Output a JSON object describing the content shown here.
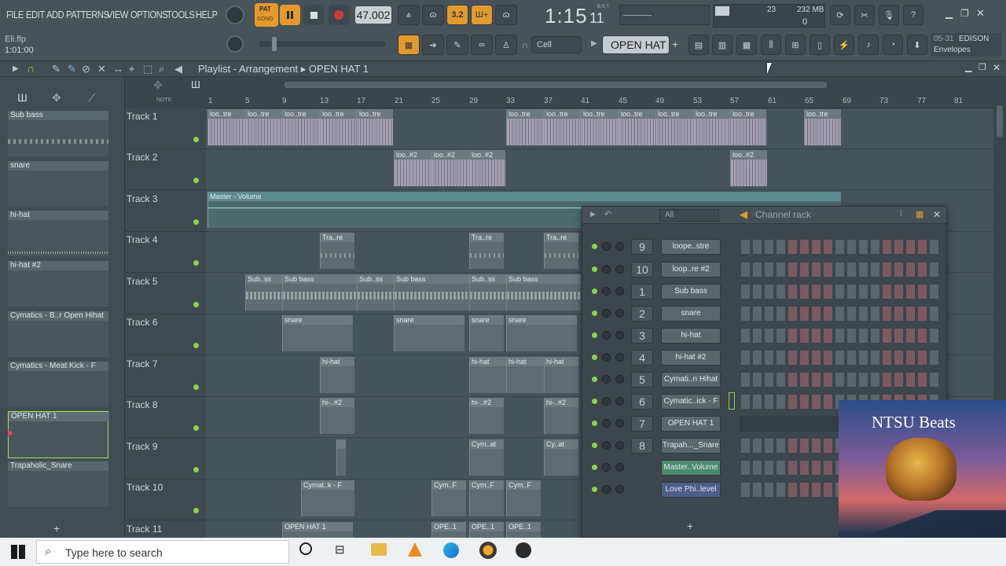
{
  "menu": {
    "items": [
      "FILE",
      "EDIT",
      "ADD",
      "PATTERNS",
      "VIEW",
      "OPTIONS",
      "TOOLS",
      "HELP"
    ]
  },
  "transport": {
    "pat_label": "PAT",
    "song_label": "SONG",
    "tempo": "47.002",
    "time": "1:15",
    "time_sub": "11",
    "time_sup": "B:S:T"
  },
  "monitor": {
    "cpu": "23",
    "ram": "232 MB",
    "voices": "0"
  },
  "project": {
    "file": "Eli.flp",
    "time": "1:01:00"
  },
  "snap": {
    "value": "Cell"
  },
  "pattern_selector": {
    "value": "OPEN HAT 1"
  },
  "hint": {
    "date": "05-31",
    "plugin": "EDISON",
    "sub": "Envelopes"
  },
  "playlist": {
    "title": "Playlist - Arrangement",
    "pattern": "OPEN HAT 1"
  },
  "ruler": {
    "marks": [
      "1",
      "5",
      "9",
      "13",
      "17",
      "21",
      "25",
      "29",
      "33",
      "37",
      "41",
      "45",
      "49",
      "53",
      "57",
      "61",
      "65",
      "69",
      "73",
      "77",
      "81"
    ]
  },
  "patterns": [
    {
      "name": "Sub bass"
    },
    {
      "name": "snare"
    },
    {
      "name": "hi-hat"
    },
    {
      "name": "hi-hat #2"
    },
    {
      "name": "Cymatics - B..r Open Hihat"
    },
    {
      "name": "Cymatics - Meat Kick - F"
    },
    {
      "name": "OPEN HAT 1"
    },
    {
      "name": "Trapaholic_Snare"
    }
  ],
  "tracks": [
    "Track 1",
    "Track 2",
    "Track 3",
    "Track 4",
    "Track 5",
    "Track 6",
    "Track 7",
    "Track 8",
    "Track 9",
    "Track 10",
    "Track 11"
  ],
  "clips": {
    "t1": [
      "loo..tre",
      "loo..tre",
      "loo..tre",
      "loo..tre",
      "loo..tre",
      "loo..tre",
      "loo..tre",
      "loo..tre",
      "loo..tre",
      "loo..tre",
      "loo..tre",
      "loo..tre",
      "loo..tre"
    ],
    "t2": [
      "loo..#2",
      "loo..#2",
      "loo..#2",
      "loo..#2"
    ],
    "t3": "Master - Volume",
    "t4": [
      "Tra..re",
      "Tra..re",
      "Tra..re"
    ],
    "t5": [
      "Sub..ss",
      "Sub bass",
      "Sub..ss",
      "Sub bass",
      "Sub..ss",
      "Sub bass"
    ],
    "t6": [
      "snare",
      "snare",
      "snare",
      "snare"
    ],
    "t7": [
      "hi-hat",
      "hi-hat",
      "hi-hat",
      "hi-hat"
    ],
    "t8": [
      "hi-..#2",
      "hi-..#2",
      "hi-..#2"
    ],
    "t9": [
      "Cym..at",
      "Cy..at"
    ],
    "t10": [
      "Cymat..k - F",
      "Cym..F",
      "Cym..F",
      "Cym..F"
    ],
    "t11": [
      "OPEN HAT 1",
      "OPE..1",
      "OPE..1",
      "OPE..1"
    ]
  },
  "channel_rack": {
    "title": "Channel rack",
    "filter": "All",
    "channels": [
      {
        "num": "9",
        "name": "loope..stre"
      },
      {
        "num": "10",
        "name": "loop..re #2"
      },
      {
        "num": "1",
        "name": "Sub bass"
      },
      {
        "num": "2",
        "name": "snare"
      },
      {
        "num": "3",
        "name": "hi-hat"
      },
      {
        "num": "4",
        "name": "hi-hat #2"
      },
      {
        "num": "5",
        "name": "Cymati..n Hihat"
      },
      {
        "num": "6",
        "name": "Cymatic..ick - F"
      },
      {
        "num": "7",
        "name": "OPEN HAT 1"
      },
      {
        "num": "8",
        "name": "Trapah..._Snare"
      },
      {
        "num": "",
        "name": "Master..Volume"
      },
      {
        "num": "",
        "name": "Love Phi..level"
      }
    ]
  },
  "taskbar": {
    "search_placeholder": "Type here to search"
  },
  "overlay": {
    "title": "NTSU Beats"
  }
}
